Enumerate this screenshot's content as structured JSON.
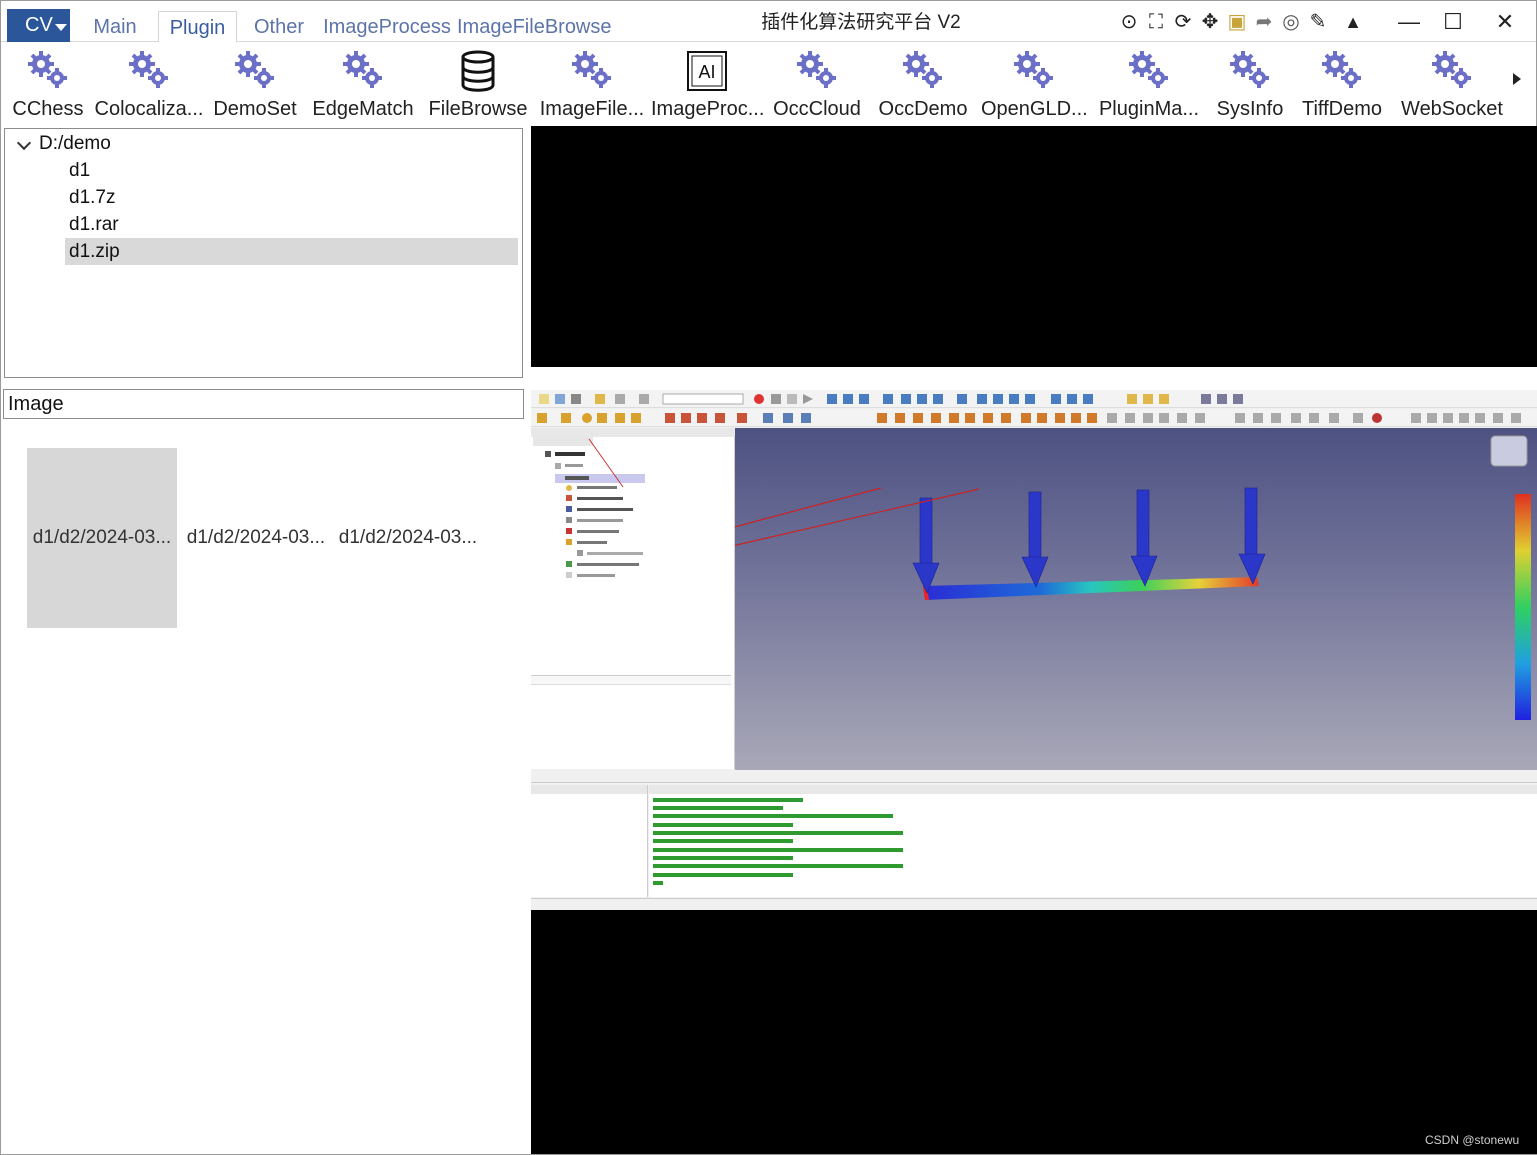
{
  "app": {
    "title": "插件化算法研究平台 V2",
    "menu_button": "CV",
    "tabs": [
      {
        "label": "Main"
      },
      {
        "label": "Plugin"
      },
      {
        "label": "Other"
      },
      {
        "label": "ImageProcess"
      },
      {
        "label": "ImageFileBrowse"
      }
    ],
    "active_tab": "Plugin"
  },
  "ribbon": {
    "plugins": [
      {
        "label": "CChess",
        "icon": "gear-icon"
      },
      {
        "label": "Colocaliza...",
        "icon": "gear-icon"
      },
      {
        "label": "DemoSet",
        "icon": "gear-icon"
      },
      {
        "label": "EdgeMatch",
        "icon": "gear-icon"
      },
      {
        "label": "FileBrowse",
        "icon": "database-icon"
      },
      {
        "label": "ImageFile...",
        "icon": "gear-icon"
      },
      {
        "label": "ImageProc...",
        "icon": "ai-icon"
      },
      {
        "label": "OccCloud",
        "icon": "gear-icon"
      },
      {
        "label": "OccDemo",
        "icon": "gear-icon"
      },
      {
        "label": "OpenGLD...",
        "icon": "gear-icon"
      },
      {
        "label": "PluginMa...",
        "icon": "gear-icon"
      },
      {
        "label": "SysInfo",
        "icon": "gear-icon"
      },
      {
        "label": "TiffDemo",
        "icon": "gear-icon"
      },
      {
        "label": "WebSocket",
        "icon": "gear-icon"
      }
    ]
  },
  "tree": {
    "root": "D:/demo",
    "items": [
      "d1",
      "d1.7z",
      "d1.rar",
      "d1.zip"
    ],
    "selected": "d1.zip"
  },
  "image_panel": {
    "label": "Image",
    "thumbnails": [
      "d1/d2/2024-03...",
      "d1/d2/2024-03...",
      "d1/d2/2024-03..."
    ]
  },
  "watermark": "CSDN @stonewu",
  "colors": {
    "accent": "#2b579a",
    "tab_text": "#5d74a8",
    "selection": "#d9d9d9",
    "display_bg": "#000000"
  }
}
